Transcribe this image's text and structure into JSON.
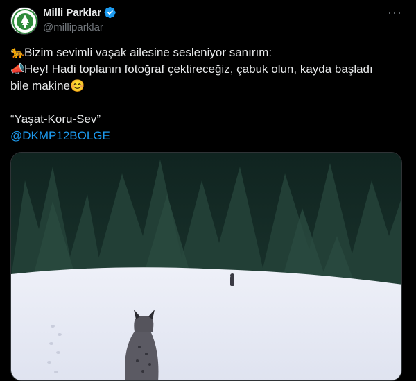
{
  "author": {
    "display_name": "Milli Parklar",
    "handle": "@milliparklar",
    "avatar_icon": "milli-parklar-logo-icon",
    "verified_icon": "verified-badge-icon",
    "verified_color": "#1d9bf0"
  },
  "more_icon": "more-options-icon",
  "tweet": {
    "line1_emoji": "🐆",
    "line1_text": "Bizim sevimli vaşak ailesine sesleniyor sanırım:",
    "line2_emoji": "📣",
    "line2_text": "Hey! Hadi toplanın fotoğraf çektireceğiz, çabuk olun, kayda başladı",
    "line3_text": "bile makine",
    "line3_emoji": "😊",
    "quote": "“Yaşat-Koru-Sev”",
    "mention": "@DKMP12BOLGE"
  },
  "media": {
    "description_icon": "lynx-in-snow-photo",
    "colors": {
      "snow": "#e9ecf6",
      "forest": "#1e3a33",
      "sky": "#16282a"
    }
  }
}
